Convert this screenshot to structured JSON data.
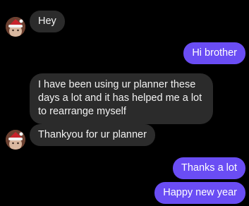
{
  "colors": {
    "background": "#000000",
    "incoming_bubble": "#2b2b2b",
    "outgoing_bubble": "#6a4df4"
  },
  "messages": [
    {
      "direction": "incoming",
      "text": "Hey",
      "avatar": "santa-hat-avatar"
    },
    {
      "direction": "outgoing",
      "text": "Hi brother"
    },
    {
      "direction": "incoming",
      "text": "I have been using ur planner these days a lot and it has helped me a lot to rearrange myself"
    },
    {
      "direction": "incoming",
      "text": "Thankyou for ur planner",
      "avatar": "santa-hat-avatar"
    },
    {
      "direction": "outgoing",
      "text": "Thanks a lot"
    },
    {
      "direction": "outgoing",
      "text": "Happy new year"
    }
  ]
}
